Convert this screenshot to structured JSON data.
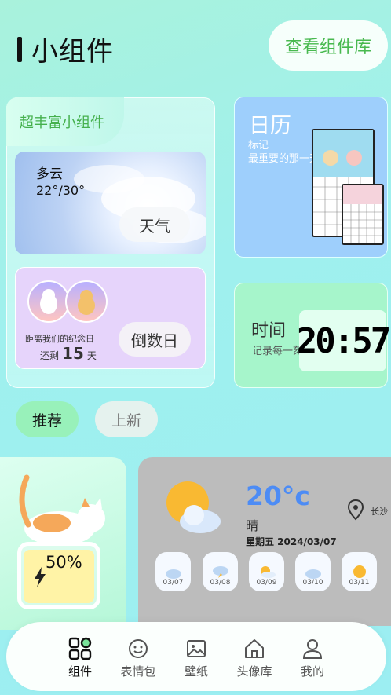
{
  "header": {
    "title": "小组件",
    "library_button": "查看组件库"
  },
  "rich_card": {
    "tab_label": "超丰富小组件",
    "weather": {
      "condition": "多云",
      "temp_range": "22°/30°",
      "button": "天气"
    },
    "countdown": {
      "note": "距离我们的纪念日",
      "remain_prefix": "还剩",
      "days": "15",
      "unit": "天",
      "button": "倒数日"
    }
  },
  "calendar_card": {
    "title": "日历",
    "subtitle": "标记\n最重要的那一天"
  },
  "time_card": {
    "title": "时间",
    "subtitle": "记录每一刻",
    "clock": "20:57"
  },
  "filter_tabs": [
    {
      "label": "推荐",
      "active": true
    },
    {
      "label": "上新",
      "active": false
    }
  ],
  "battery_widget": {
    "percent": "50%",
    "level": 0.5
  },
  "weather_widget": {
    "temp": "20°c",
    "condition": "晴",
    "date": "星期五 2024/03/07",
    "city": "长沙",
    "forecast": [
      {
        "date": "03/07",
        "icon": "cloud-icon"
      },
      {
        "date": "03/08",
        "icon": "thunder-cloud-icon"
      },
      {
        "date": "03/09",
        "icon": "sun-cloud-icon"
      },
      {
        "date": "03/10",
        "icon": "cloud-icon"
      },
      {
        "date": "03/11",
        "icon": "sun-icon"
      }
    ]
  },
  "nav": [
    {
      "label": "组件",
      "icon": "widgets-icon",
      "active": true
    },
    {
      "label": "表情包",
      "icon": "emoji-icon",
      "active": false
    },
    {
      "label": "壁纸",
      "icon": "image-icon",
      "active": false
    },
    {
      "label": "头像库",
      "icon": "home-icon",
      "active": false
    },
    {
      "label": "我的",
      "icon": "user-icon",
      "active": false
    }
  ],
  "colors": {
    "accent": "#48b94f",
    "temp": "#4d8cf5"
  }
}
